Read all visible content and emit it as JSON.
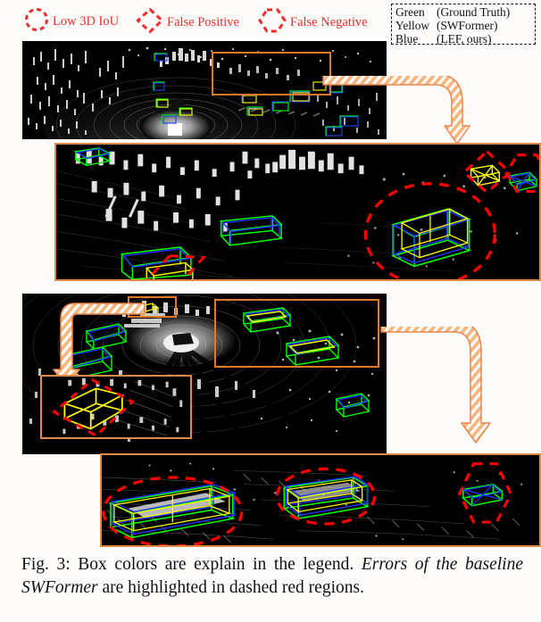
{
  "figure": {
    "caption_prefix": "Fig. 3: Box colors are explain in the legend. ",
    "caption_italic": "Errors of the baseline SWFormer",
    "caption_suffix": " are highlighted in dashed red regions.",
    "caption_full": "Fig. 3: Box colors are explain in the legend. Errors of the baseline SWFormer are highlighted in dashed red regions."
  },
  "legend": {
    "accent_red": "#ef2b2b",
    "items": [
      {
        "icon": "dashed-circle",
        "label": "Low 3D IoU"
      },
      {
        "icon": "dashed-diamond",
        "label": "False Positive"
      },
      {
        "icon": "dashed-hexagon",
        "label": "False Negative"
      }
    ]
  },
  "color_legend": {
    "border_style": "dashed",
    "rows": [
      {
        "color_name": "Green",
        "source": "(Ground Truth)",
        "hex": "#00ff00"
      },
      {
        "color_name": "Yellow",
        "source": "(SWFormer)",
        "hex": "#ffff00"
      },
      {
        "color_name": "Blue",
        "source": "(LEF, ours)",
        "hex": "#2233ff"
      }
    ]
  },
  "panels": [
    {
      "id": "scene-a-overview",
      "name": "Scene A full LiDAR point cloud overview",
      "roi_count": 1
    },
    {
      "id": "scene-a-zoom",
      "name": "Scene A zoomed detail crop",
      "error_markers": [
        "Low 3D IoU",
        "False Positive",
        "False Negative",
        "False Positive"
      ]
    },
    {
      "id": "scene-b-overview",
      "name": "Scene B full LiDAR point cloud overview",
      "roi_count": 2
    },
    {
      "id": "scene-b-inset",
      "name": "Scene B small zoomed inset",
      "error_markers": [
        "False Positive"
      ]
    },
    {
      "id": "scene-b-zoom",
      "name": "Scene B zoomed detail crop",
      "error_markers": [
        "Low 3D IoU",
        "Low 3D IoU",
        "False Negative"
      ]
    }
  ],
  "colors": {
    "ground_truth": "#00ff00",
    "swformer": "#ffff00",
    "lef_ours": "#2233ff",
    "error_marker": "#ff0000",
    "roi_box": "#e07a28",
    "arrow": "#f3a05c",
    "page_bg": "#fdfcfa"
  }
}
